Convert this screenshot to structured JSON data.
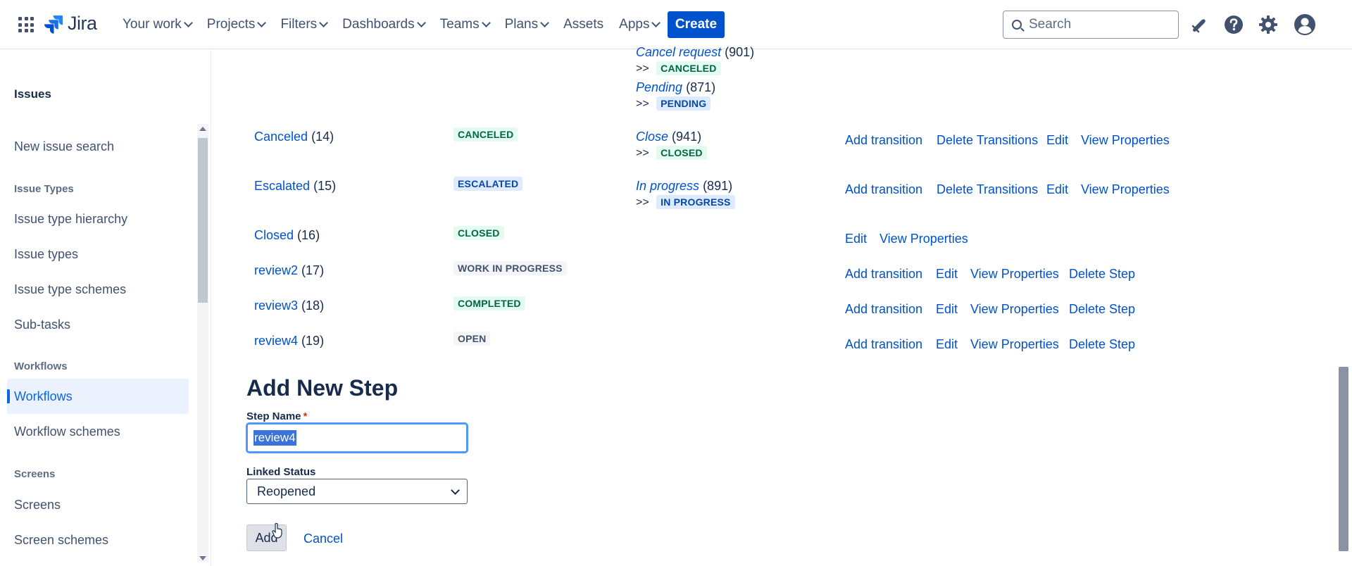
{
  "nav": {
    "logo_text": "Jira",
    "menu": [
      {
        "label": "Your work",
        "dropdown": true
      },
      {
        "label": "Projects",
        "dropdown": true
      },
      {
        "label": "Filters",
        "dropdown": true
      },
      {
        "label": "Dashboards",
        "dropdown": true
      },
      {
        "label": "Teams",
        "dropdown": true
      },
      {
        "label": "Plans",
        "dropdown": true
      },
      {
        "label": "Assets",
        "dropdown": false
      },
      {
        "label": "Apps",
        "dropdown": true
      }
    ],
    "create_label": "Create",
    "search_placeholder": "Search",
    "accent": "#0052cc"
  },
  "sidebar": {
    "title": "Issues",
    "items": {
      "new_issue_search": "New issue search",
      "issue_types_section": "Issue Types",
      "issue_type_hierarchy": "Issue type hierarchy",
      "issue_types": "Issue types",
      "issue_type_schemes": "Issue type schemes",
      "sub_tasks": "Sub-tasks",
      "workflows_section": "Workflows",
      "workflows": "Workflows",
      "workflow_schemes": "Workflow schemes",
      "screens_section": "Screens",
      "screens": "Screens",
      "screen_schemes": "Screen schemes"
    }
  },
  "top_transitions": [
    {
      "name": "Cancel request",
      "id": "(901)",
      "status": "CANCELED"
    },
    {
      "name": "Pending",
      "id": "(871)",
      "status": "PENDING"
    }
  ],
  "steps": [
    {
      "name": "Canceled",
      "id": "(14)",
      "status": "CANCELED",
      "transition": {
        "name": "Close",
        "id": "(941)",
        "status": "CLOSED"
      },
      "actions": [
        "Add transition",
        "Delete Transitions",
        "Edit",
        "View Properties"
      ]
    },
    {
      "name": "Escalated",
      "id": "(15)",
      "status": "ESCALATED",
      "transition": {
        "name": "In progress",
        "id": "(891)",
        "status": "IN PROGRESS"
      },
      "actions": [
        "Add transition",
        "Delete Transitions",
        "Edit",
        "View Properties"
      ]
    },
    {
      "name": "Closed",
      "id": "(16)",
      "status": "CLOSED",
      "actions": [
        "Edit",
        "View Properties"
      ]
    },
    {
      "name": "review2",
      "id": "(17)",
      "status": "WORK IN PROGRESS",
      "actions": [
        "Add transition",
        "Edit",
        "View Properties",
        "Delete Step"
      ]
    },
    {
      "name": "review3",
      "id": "(18)",
      "status": "COMPLETED",
      "actions": [
        "Add transition",
        "Edit",
        "View Properties",
        "Delete Step"
      ]
    },
    {
      "name": "review4",
      "id": "(19)",
      "status": "OPEN",
      "actions": [
        "Add transition",
        "Edit",
        "View Properties",
        "Delete Step"
      ]
    }
  ],
  "arrow_prefix": ">>",
  "form": {
    "title": "Add New Step",
    "step_name_label": "Step Name",
    "required_mark": "*",
    "step_name_value": "review4",
    "linked_status_label": "Linked Status",
    "linked_status_value": "Reopened",
    "add_label": "Add",
    "cancel_label": "Cancel"
  }
}
